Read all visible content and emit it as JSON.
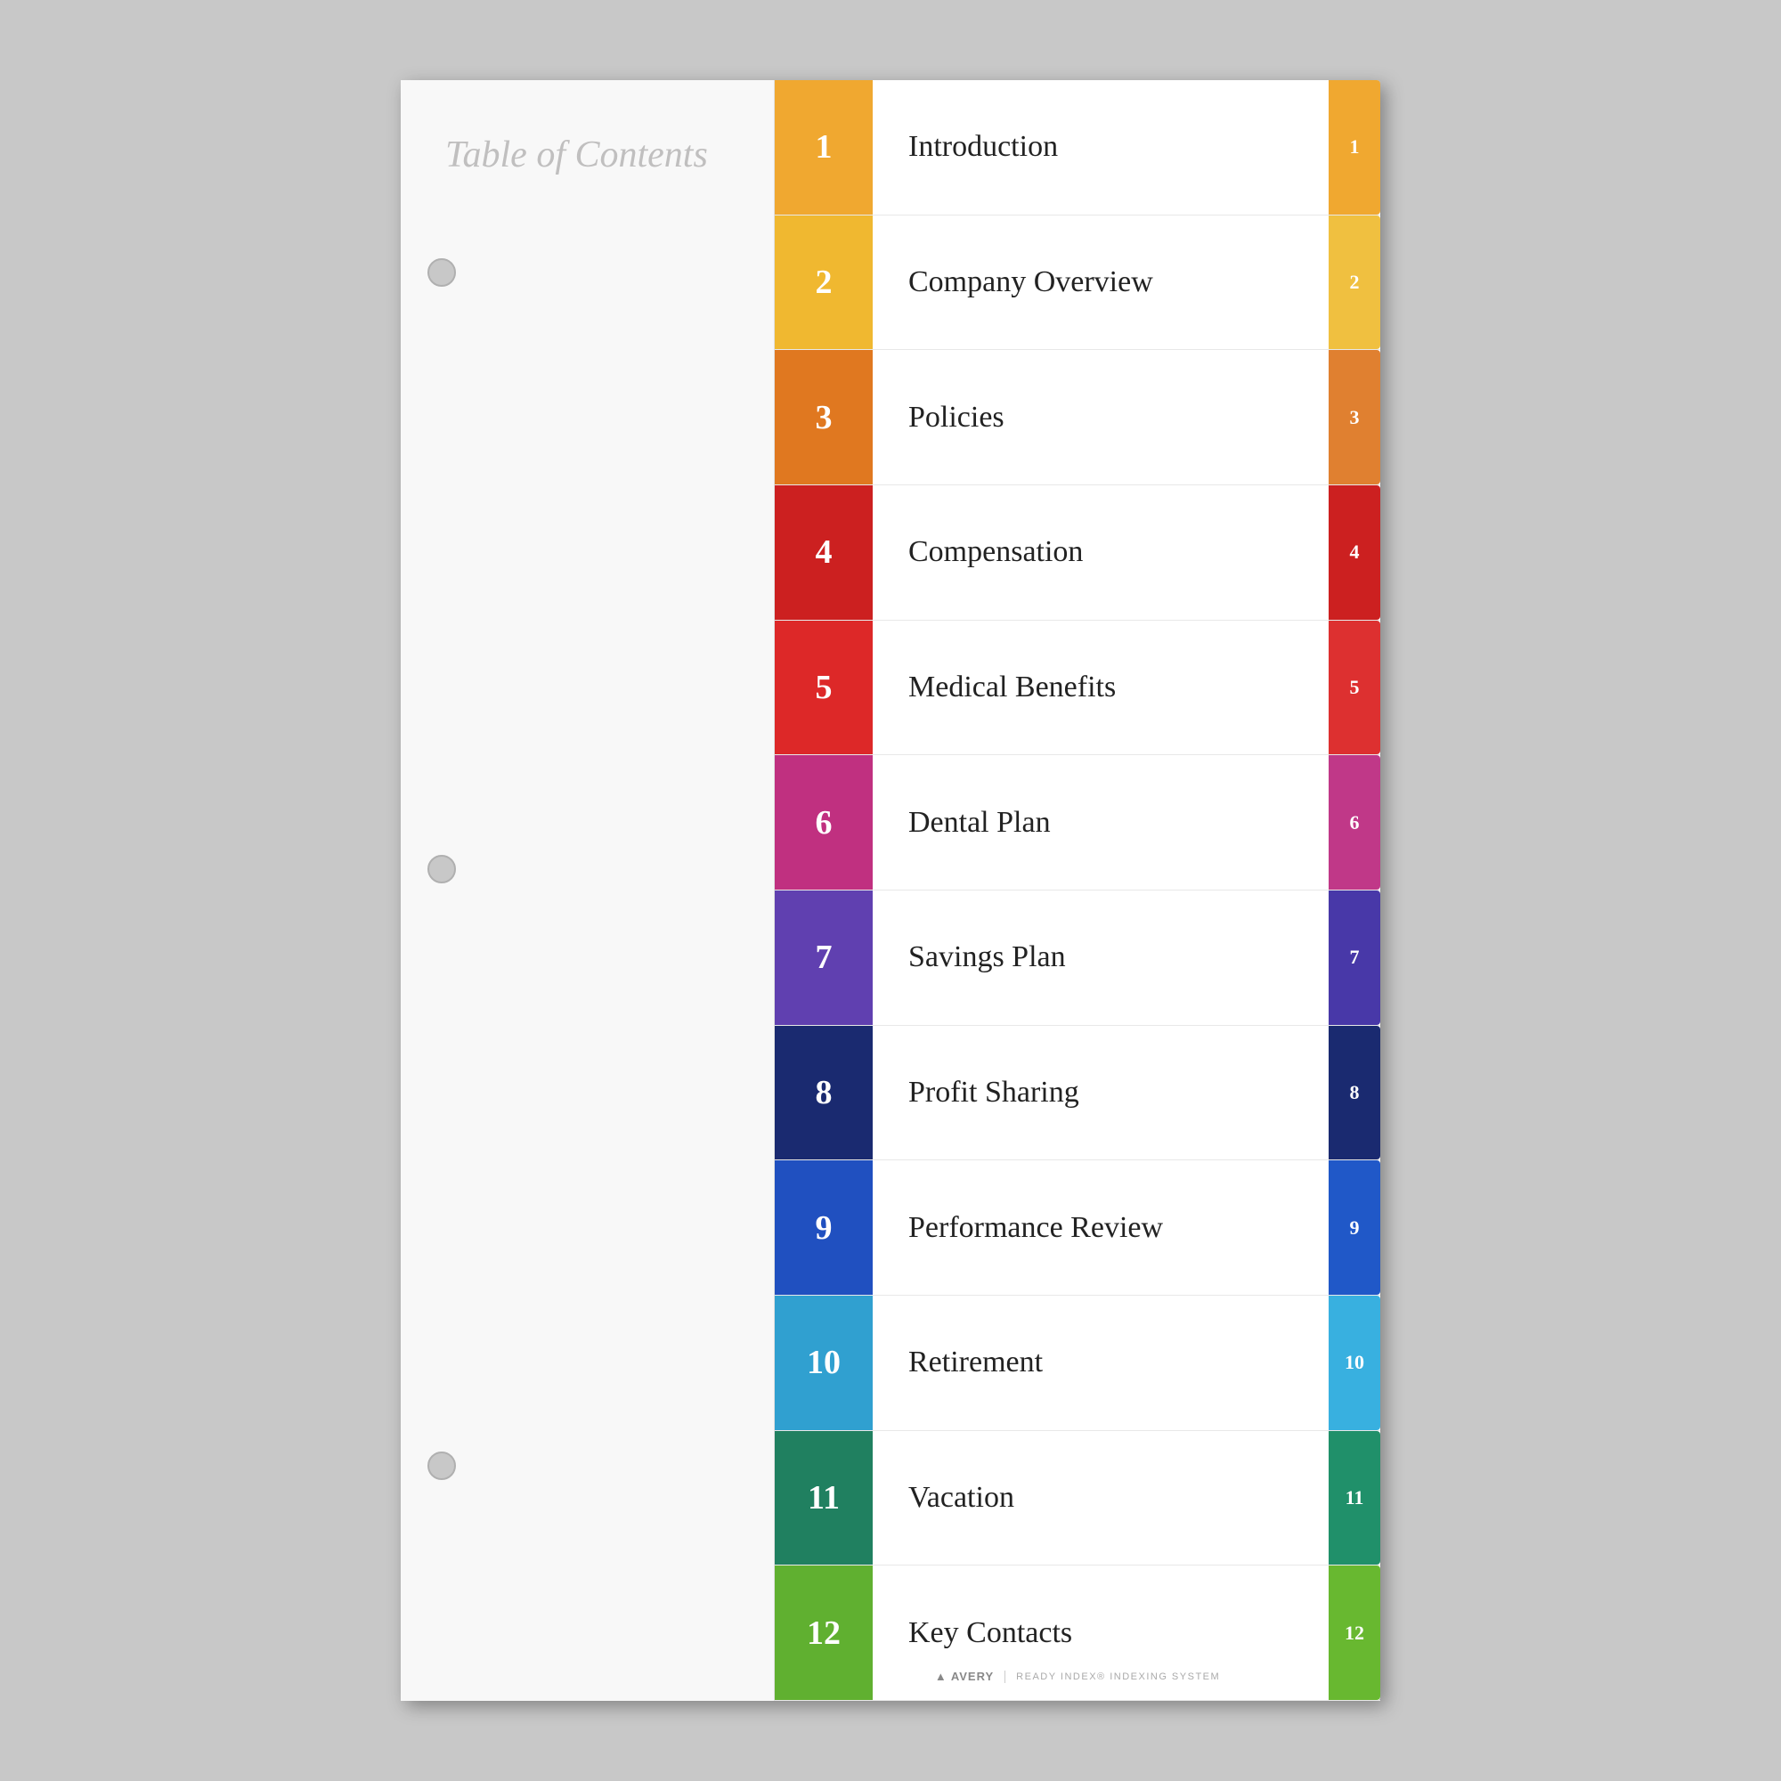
{
  "title": "Table of Contents",
  "entries": [
    {
      "number": "1",
      "label": "Introduction",
      "colorClass": "color-1",
      "tabClass": "tab-1"
    },
    {
      "number": "2",
      "label": "Company Overview",
      "colorClass": "color-2",
      "tabClass": "tab-2"
    },
    {
      "number": "3",
      "label": "Policies",
      "colorClass": "color-3",
      "tabClass": "tab-3"
    },
    {
      "number": "4",
      "label": "Compensation",
      "colorClass": "color-4",
      "tabClass": "tab-4"
    },
    {
      "number": "5",
      "label": "Medical Benefits",
      "colorClass": "color-5",
      "tabClass": "tab-5"
    },
    {
      "number": "6",
      "label": "Dental Plan",
      "colorClass": "color-6",
      "tabClass": "tab-6"
    },
    {
      "number": "7",
      "label": "Savings Plan",
      "colorClass": "color-7",
      "tabClass": "tab-7"
    },
    {
      "number": "8",
      "label": "Profit Sharing",
      "colorClass": "color-8",
      "tabClass": "tab-8"
    },
    {
      "number": "9",
      "label": "Performance Review",
      "colorClass": "color-9",
      "tabClass": "tab-9"
    },
    {
      "number": "10",
      "label": "Retirement",
      "colorClass": "color-10",
      "tabClass": "tab-10"
    },
    {
      "number": "11",
      "label": "Vacation",
      "colorClass": "color-11",
      "tabClass": "tab-11"
    },
    {
      "number": "12",
      "label": "Key Contacts",
      "colorClass": "color-12",
      "tabClass": "tab-12"
    }
  ],
  "footer": {
    "brand": "AVERY",
    "tagline": "READY INDEX® INDEXING SYSTEM"
  }
}
